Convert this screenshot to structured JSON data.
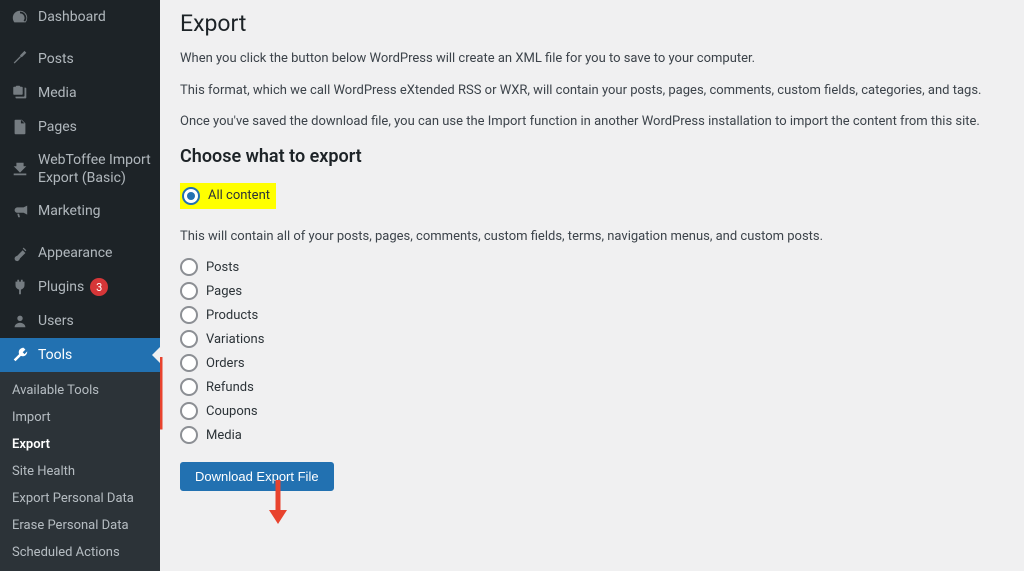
{
  "sidebar": {
    "items": [
      {
        "label": "Dashboard",
        "icon": "dashboard"
      },
      {
        "label": "Posts",
        "icon": "pin"
      },
      {
        "label": "Media",
        "icon": "media"
      },
      {
        "label": "Pages",
        "icon": "pages"
      },
      {
        "label": "WebToffee Import Export (Basic)",
        "icon": "import-export"
      },
      {
        "label": "Marketing",
        "icon": "megaphone"
      },
      {
        "label": "Appearance",
        "icon": "brush"
      },
      {
        "label": "Plugins",
        "icon": "plug",
        "badge": "3"
      },
      {
        "label": "Users",
        "icon": "users"
      },
      {
        "label": "Tools",
        "icon": "wrench",
        "active": true
      }
    ],
    "submenu": [
      {
        "label": "Available Tools"
      },
      {
        "label": "Import"
      },
      {
        "label": "Export",
        "current": true
      },
      {
        "label": "Site Health"
      },
      {
        "label": "Export Personal Data"
      },
      {
        "label": "Erase Personal Data"
      },
      {
        "label": "Scheduled Actions"
      }
    ]
  },
  "page": {
    "title": "Export",
    "intro1": "When you click the button below WordPress will create an XML file for you to save to your computer.",
    "intro2": "This format, which we call WordPress eXtended RSS or WXR, will contain your posts, pages, comments, custom fields, categories, and tags.",
    "intro3": "Once you've saved the download file, you can use the Import function in another WordPress installation to import the content from this site.",
    "choose_heading": "Choose what to export",
    "options": [
      {
        "label": "All content",
        "checked": true,
        "highlighted": true
      },
      {
        "label": "Posts"
      },
      {
        "label": "Pages"
      },
      {
        "label": "Products"
      },
      {
        "label": "Variations"
      },
      {
        "label": "Orders"
      },
      {
        "label": "Refunds"
      },
      {
        "label": "Coupons"
      },
      {
        "label": "Media"
      }
    ],
    "all_content_desc": "This will contain all of your posts, pages, comments, custom fields, terms, navigation menus, and custom posts.",
    "download_button": "Download Export File"
  }
}
